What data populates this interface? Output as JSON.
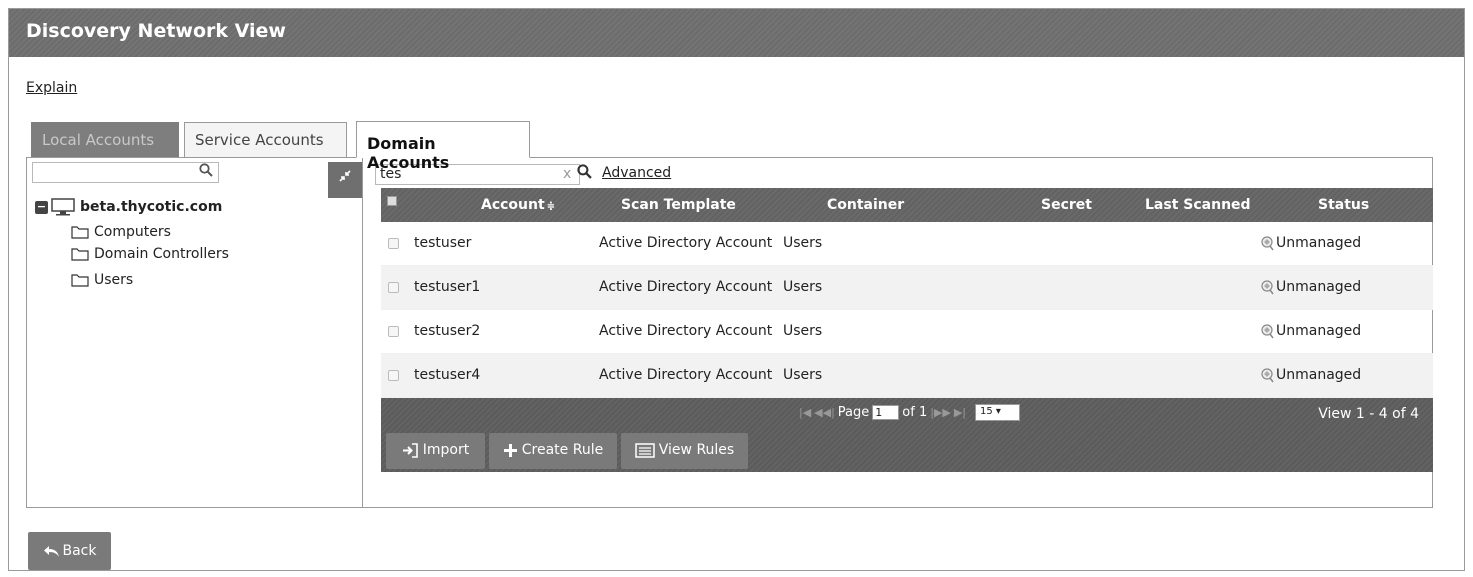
{
  "window": {
    "title": "Discovery Network View"
  },
  "explain_link": "Explain",
  "tabs": [
    {
      "label": "Local Accounts",
      "state": "disabled"
    },
    {
      "label": "Service Accounts",
      "state": "inactive"
    },
    {
      "label": "Domain Accounts",
      "state": "active"
    }
  ],
  "tree": {
    "search_value": "",
    "root": "beta.thycotic.com",
    "children": [
      "Computers",
      "Domain Controllers",
      "Users"
    ]
  },
  "grid_search": {
    "value": "tes",
    "clear_label": "x",
    "advanced_label": "Advanced"
  },
  "grid": {
    "columns": [
      "Account",
      "Scan Template",
      "Container",
      "Secret",
      "Last Scanned",
      "Status"
    ],
    "rows": [
      {
        "account": "testuser",
        "scan_template": "Active Directory Account",
        "container": "Users",
        "secret": "",
        "last_scanned": "",
        "status": "Unmanaged"
      },
      {
        "account": "testuser1",
        "scan_template": "Active Directory Account",
        "container": "Users",
        "secret": "",
        "last_scanned": "",
        "status": "Unmanaged"
      },
      {
        "account": "testuser2",
        "scan_template": "Active Directory Account",
        "container": "Users",
        "secret": "",
        "last_scanned": "",
        "status": "Unmanaged"
      },
      {
        "account": "testuser4",
        "scan_template": "Active Directory Account",
        "container": "Users",
        "secret": "",
        "last_scanned": "",
        "status": "Unmanaged"
      }
    ]
  },
  "pager": {
    "page_label": "Page",
    "page_value": "1",
    "of_label": "of 1",
    "per_page": "15",
    "view_count": "View 1 - 4 of 4"
  },
  "buttons": {
    "import": "Import",
    "create_rule": "Create Rule",
    "view_rules": "View Rules",
    "back": "Back"
  },
  "colors": {
    "header_bg": "#6f6f6f",
    "grid_header_bg": "#656565",
    "button_bg": "#7a7a7a"
  }
}
